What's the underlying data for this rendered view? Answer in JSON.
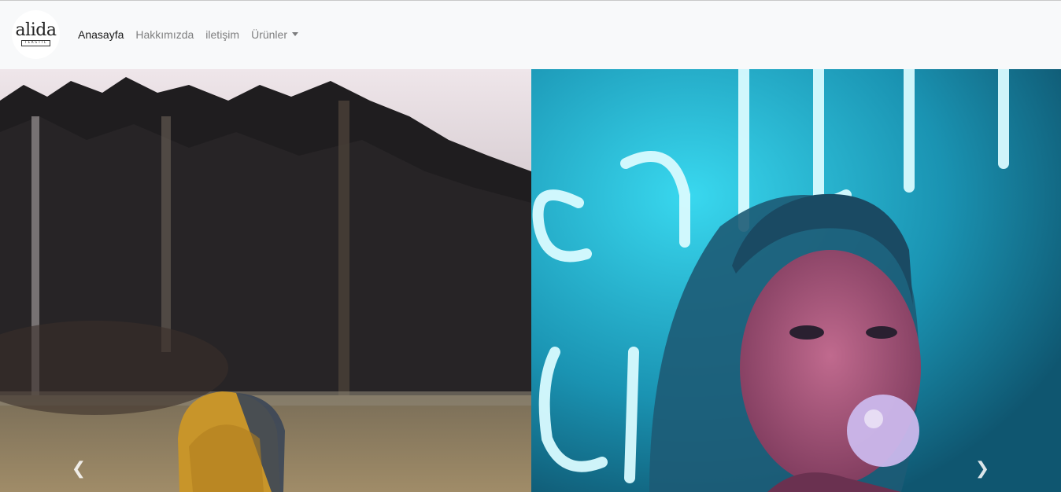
{
  "brand": {
    "word": "alida",
    "sub": "TEKSTIL"
  },
  "nav": {
    "items": [
      {
        "label": "Anasayfa",
        "active": true
      },
      {
        "label": "Hakkımızda",
        "active": false
      },
      {
        "label": "iletişim",
        "active": false
      },
      {
        "label": "Ürünler",
        "active": false,
        "dropdown": true
      }
    ]
  },
  "carousel": {
    "slides": [
      {
        "subject": "child-in-yellow-hood-forest-photo"
      },
      {
        "subject": "neon-girl-bubblegum-photo"
      }
    ],
    "prev_icon": "chevron-left-icon",
    "next_icon": "chevron-right-icon",
    "prev_glyph": "❮",
    "next_glyph": "❯"
  },
  "colors": {
    "navbar_bg": "#f8f9fa",
    "nav_active": "rgba(0,0,0,0.9)",
    "nav_inactive": "rgba(0,0,0,0.5)"
  }
}
